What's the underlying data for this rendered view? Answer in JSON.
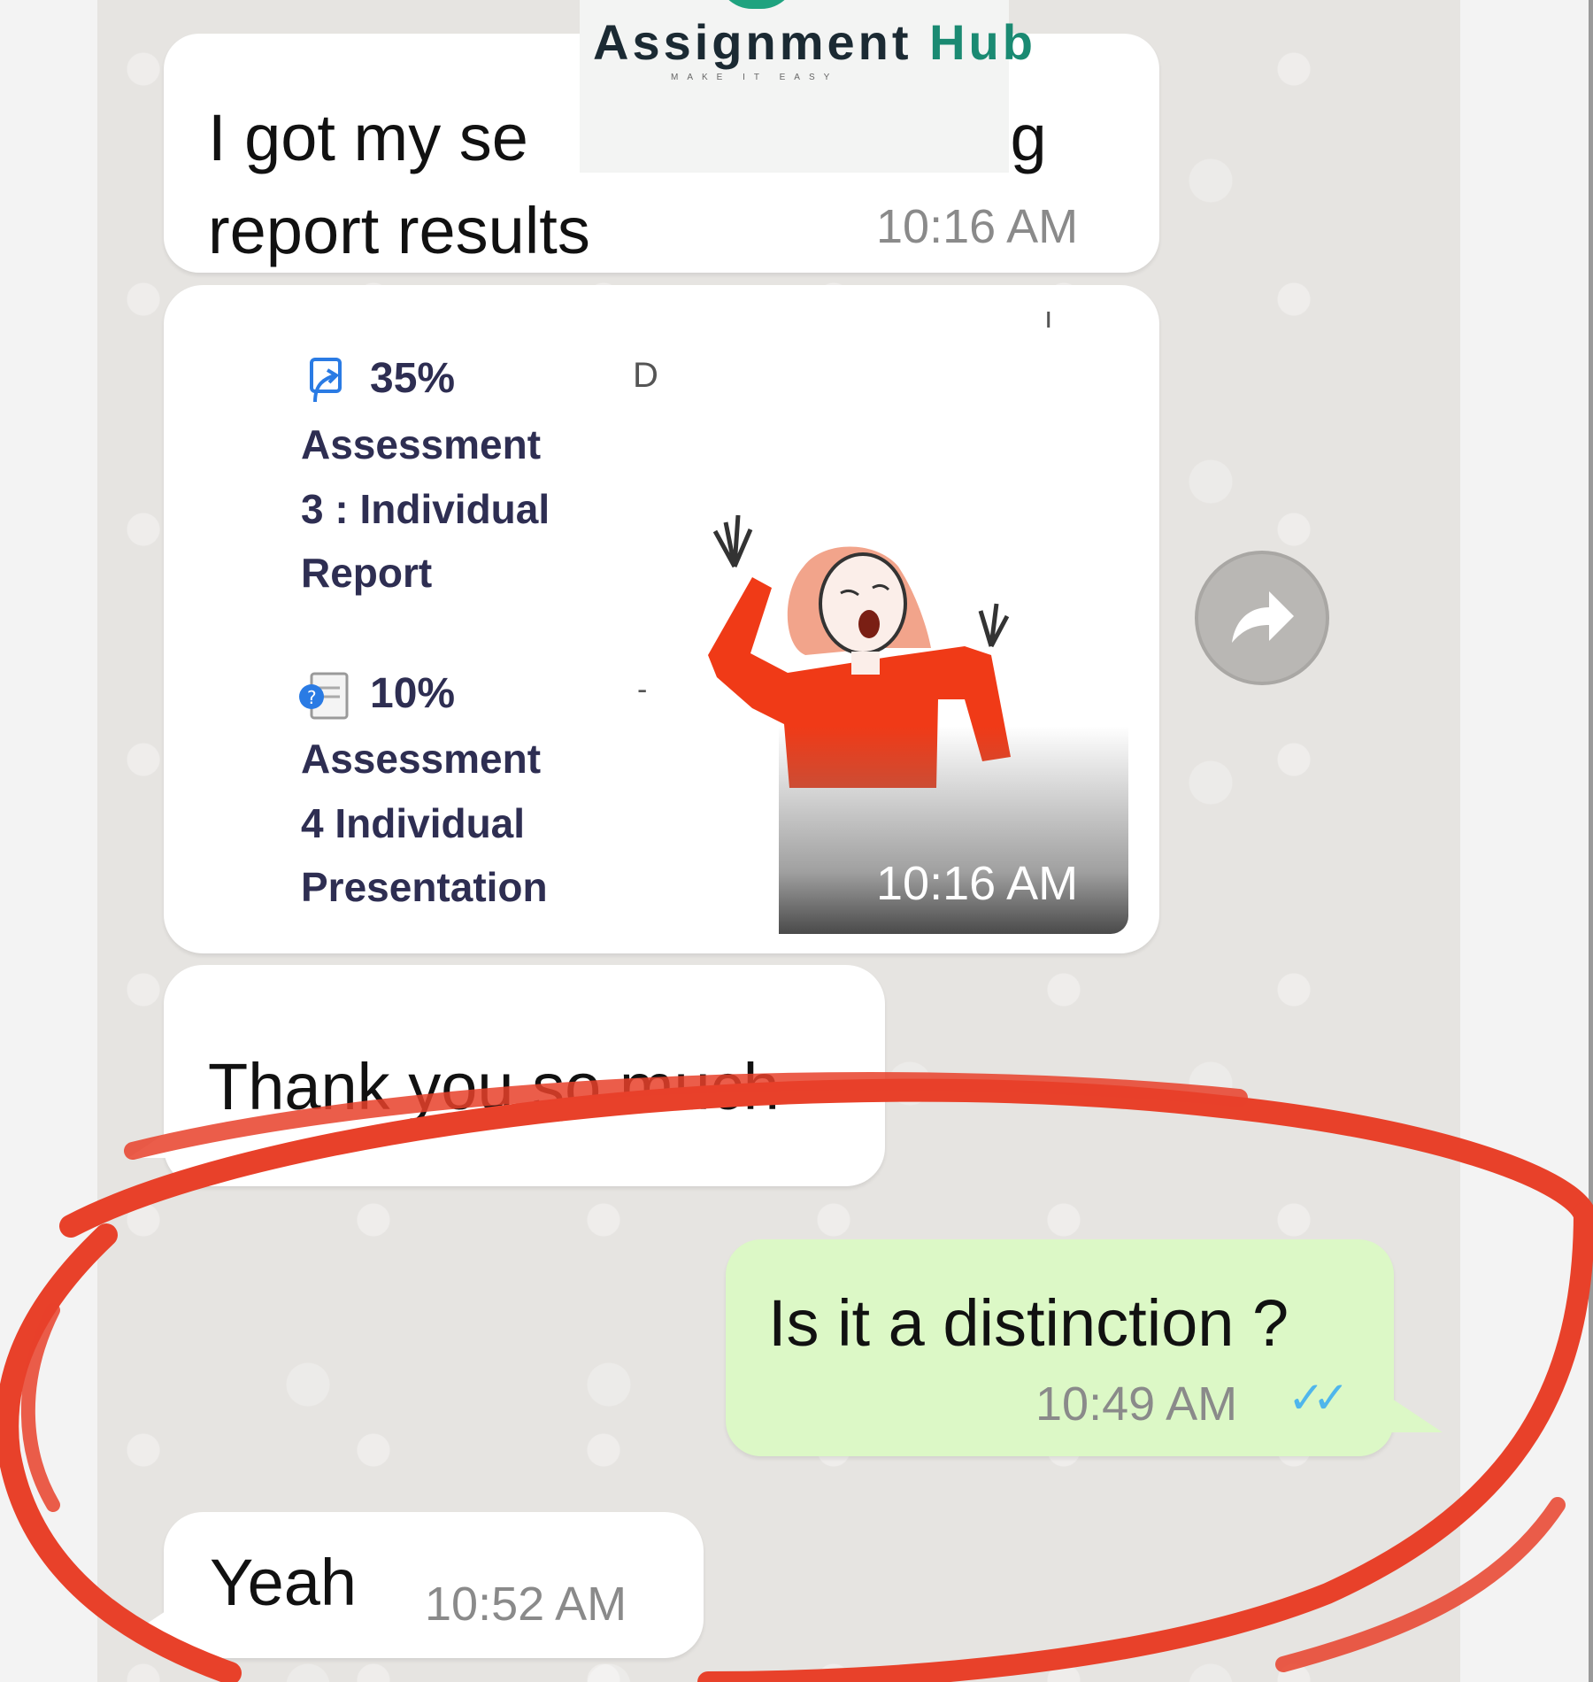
{
  "brand": {
    "title_main": "Assignment",
    "title_accent": "Hub",
    "tagline": "MAKE IT EASY"
  },
  "messages": {
    "m1": {
      "line1": "I got my se",
      "line1_end": "ig",
      "line2": "report results",
      "time": "10:16 AM"
    },
    "m2": {
      "grades": [
        {
          "percent": "35%",
          "lines": [
            "Assessment",
            "3 : Individual",
            "Report"
          ]
        },
        {
          "percent": "10%",
          "lines": [
            "Assessment",
            "4 Individual",
            "Presentation"
          ]
        }
      ],
      "grade_letter": "D",
      "time": "10:16 AM"
    },
    "m3": {
      "text": "Thank you so much"
    },
    "m4": {
      "text": "Is it a distinction ?",
      "time": "10:49 AM",
      "status": "read"
    },
    "m5": {
      "text": "Yeah",
      "time": "10:52 AM"
    }
  },
  "colors": {
    "incoming_bubble": "#ffffff",
    "outgoing_bubble": "#dcf8c6",
    "read_ticks": "#4fb6ec",
    "highlight_ring": "#e8412a",
    "brand_green": "#1a8a72"
  },
  "icons": {
    "forward": "forward-arrow-icon",
    "document_link": "document-link-icon",
    "quiz_document": "quiz-document-icon",
    "read_receipt": "double-check-icon"
  }
}
